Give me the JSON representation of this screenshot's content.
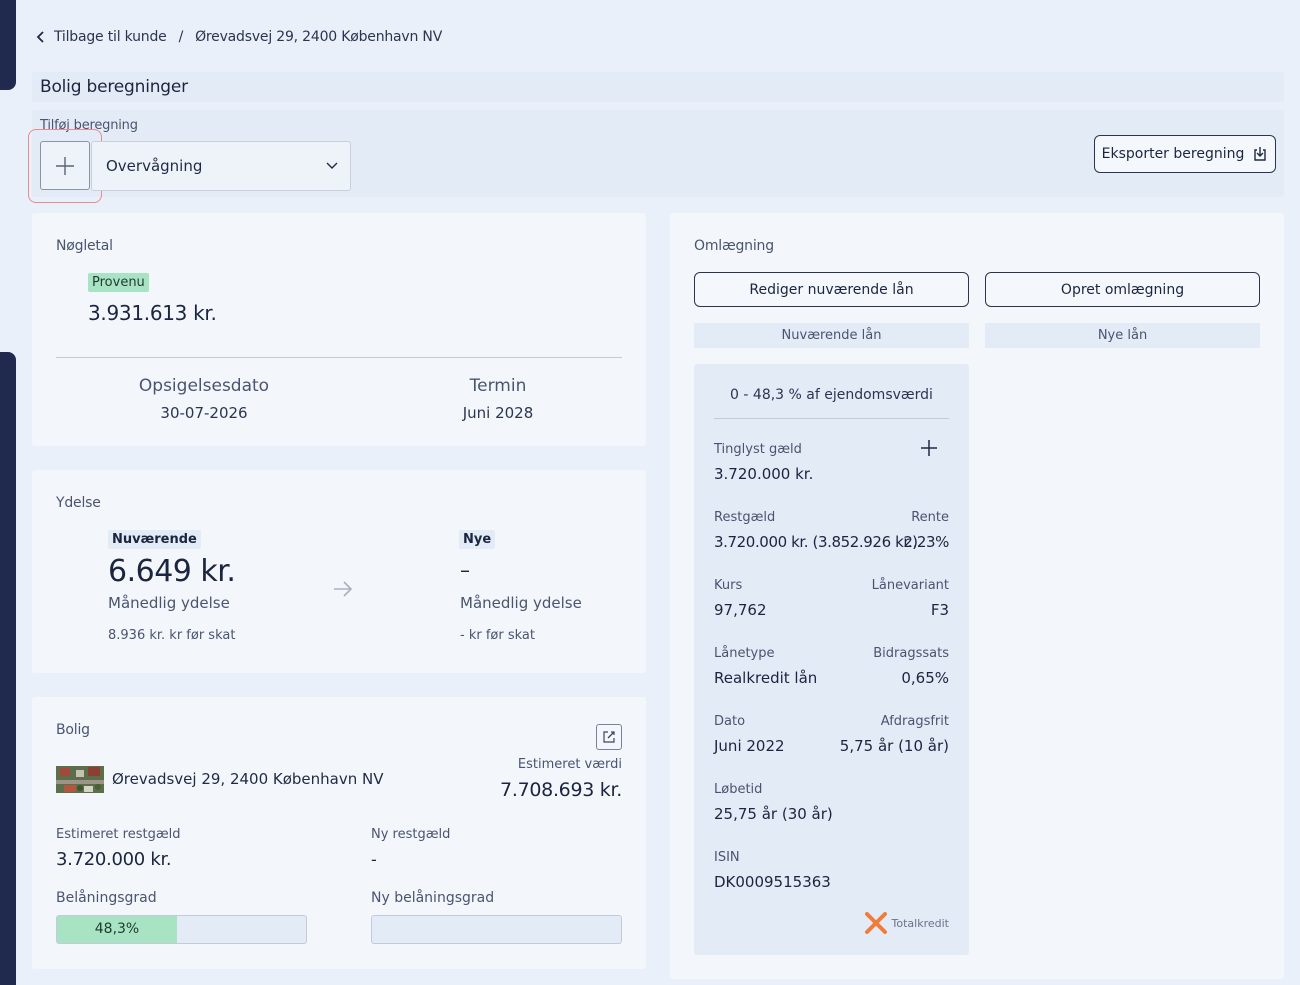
{
  "breadcrumb": {
    "back_label": "Tilbage til kunde",
    "separator": "/",
    "current": "Ørevadsvej 29, 2400 København NV"
  },
  "page": {
    "title": "Bolig beregninger"
  },
  "add_calc": {
    "label": "Tilføj beregning",
    "selected_option": "Overvågning",
    "export_label": "Eksporter beregning"
  },
  "key_figures": {
    "title": "Nøgletal",
    "provenu_label": "Provenu",
    "provenu_value": "3.931.613 kr.",
    "notice_label": "Opsigelsesdato",
    "notice_value": "30-07-2026",
    "term_label": "Termin",
    "term_value": "Juni 2028"
  },
  "payment": {
    "title": "Ydelse",
    "current_label": "Nuværende",
    "current_value": "6.649 kr.",
    "current_sub": "Månedlig ydelse",
    "current_pretax": "8.936 kr. kr før skat",
    "new_label": "Nye",
    "new_value": "–",
    "new_sub": "Månedlig ydelse",
    "new_pretax": "- kr før skat"
  },
  "home": {
    "title": "Bolig",
    "address": "Ørevadsvej 29, 2400 København NV",
    "est_value_label": "Estimeret værdi",
    "est_value": "7.708.693 kr.",
    "est_debt_label": "Estimeret restgæld",
    "est_debt": "3.720.000 kr.",
    "new_debt_label": "Ny restgæld",
    "new_debt": "-",
    "ltv_label": "Belåningsgrad",
    "ltv_value": "48,3%",
    "ltv_fraction": 0.48,
    "new_ltv_label": "Ny belåningsgrad"
  },
  "refinance": {
    "title": "Omlægning",
    "edit_button": "Rediger nuværende lån",
    "create_button": "Opret omlægning",
    "current_col": "Nuværende lån",
    "new_col": "Nye lån",
    "loan": {
      "range": "0 - 48,3 % af ejendomsværdi",
      "registered_debt_label": "Tinglyst gæld",
      "registered_debt": "3.720.000 kr.",
      "remaining_label": "Restgæld",
      "remaining": "3.720.000 kr. (3.852.926 kr.)",
      "rate_label": "Rente",
      "rate": "2,23%",
      "price_label": "Kurs",
      "price": "97,762",
      "variant_label": "Lånevariant",
      "variant": "F3",
      "type_label": "Lånetype",
      "type": "Realkredit lån",
      "fee_label": "Bidragssats",
      "fee": "0,65%",
      "date_label": "Dato",
      "date": "Juni 2022",
      "io_label": "Afdragsfrit",
      "io": "5,75 år (10 år)",
      "term_label": "Løbetid",
      "term": "25,75 år (30 år)",
      "isin_label": "ISIN",
      "isin": "DK0009515363",
      "lender": "Totalkredit"
    }
  },
  "colors": {
    "accent_green": "#a8e4c4",
    "navy": "#1f2a4e",
    "background": "#e9f0f9",
    "card": "#f3f7fc",
    "highlight": "#e98b8f",
    "totalkredit_orange": "#f07c3a"
  },
  "icons": [
    "chevron-left-icon",
    "plus-icon",
    "chevron-down-icon",
    "export-icon",
    "arrow-right-icon",
    "edit-icon",
    "house-thumbnail",
    "totalkredit-logo"
  ]
}
